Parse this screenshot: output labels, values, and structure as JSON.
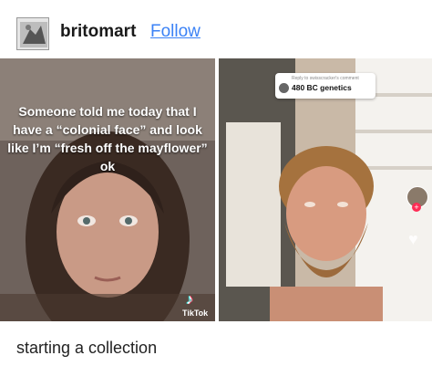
{
  "post": {
    "username": "britomart",
    "follow_label": "Follow",
    "caption": "starting a collection"
  },
  "left_video": {
    "overlay_text": "Someone told me today that I have a “colonial face” and look like I’m “fresh off the mayflower” ok",
    "watermark": "TikTok",
    "logo_icon": "tiktok-note-icon"
  },
  "right_video": {
    "reply_prefix": "Reply to swisscracker's comment",
    "reply_text": "480 BC genetics",
    "side_icons": [
      "creator-avatar-icon",
      "follow-plus-icon",
      "heart-icon"
    ]
  },
  "colors": {
    "follow_link": "#3b82f6",
    "tiktok_red": "#fe2c55",
    "tiktok_cyan": "#25f4ee"
  }
}
